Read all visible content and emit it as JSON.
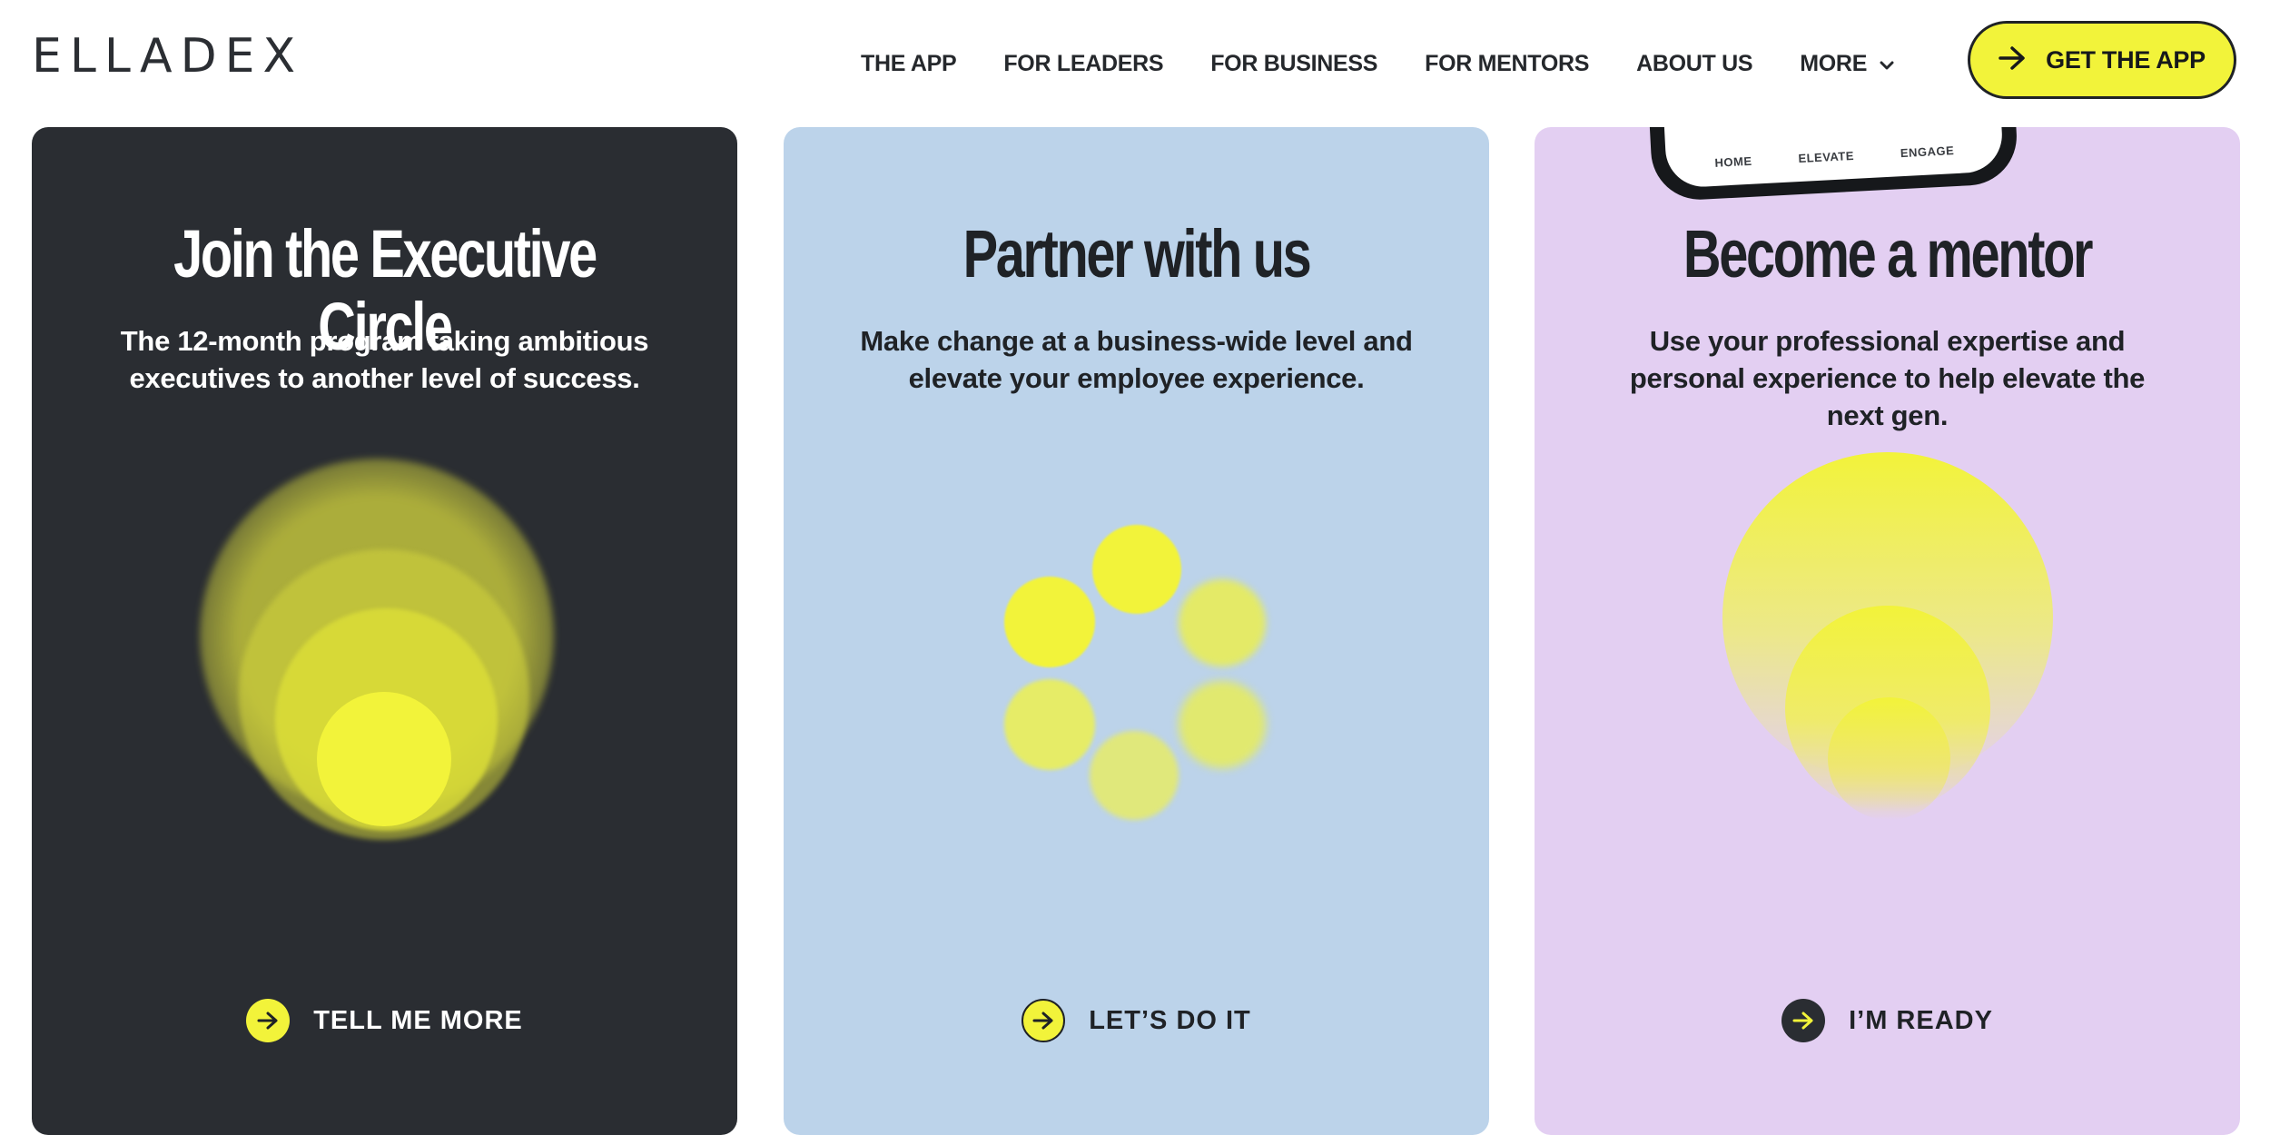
{
  "brand": {
    "logo": "ELLADEX"
  },
  "nav": {
    "items": [
      "THE APP",
      "FOR LEADERS",
      "FOR BUSINESS",
      "FOR MENTORS",
      "ABOUT US",
      "MORE"
    ],
    "cta_label": "GET THE APP"
  },
  "cards": [
    {
      "title": "Join the Executive Circle",
      "description": "The 12-month program taking ambitious executives to another level of success.",
      "action": "TELL ME MORE"
    },
    {
      "title": "Partner with us",
      "description": "Make change at a business-wide level and elevate your employee experience.",
      "action": "LET’S DO IT"
    },
    {
      "title": "Become a mentor",
      "description": "Use your professional expertise and personal experience to help elevate the next gen.",
      "action": "I’M READY",
      "phone_tabs": [
        "HOME",
        "ELEVATE",
        "ENGAGE"
      ]
    }
  ],
  "colors": {
    "accent_yellow": "#f2f33a",
    "dark": "#2a2d32",
    "blue_card": "#bcd3ea",
    "lilac_card": "#e3cff2"
  }
}
